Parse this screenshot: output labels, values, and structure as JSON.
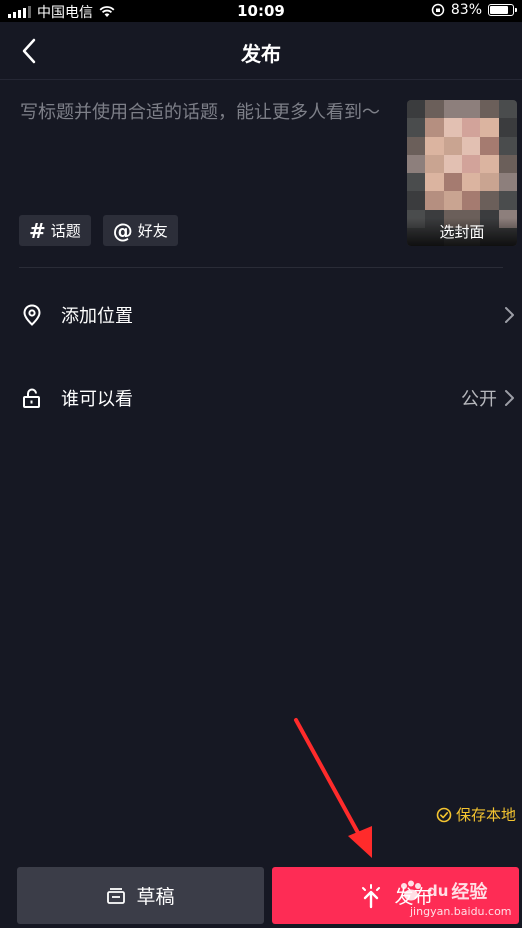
{
  "status_bar": {
    "carrier": "中国电信",
    "time": "10:09",
    "battery_percent": "83%",
    "battery_level": 0.83
  },
  "nav": {
    "title": "发布"
  },
  "composer": {
    "placeholder": "写标题并使用合适的话题，能让更多人看到～",
    "value": ""
  },
  "cover": {
    "label": "选封面"
  },
  "chips": [
    {
      "symbol": "#",
      "label": "话题"
    },
    {
      "symbol": "@",
      "label": "好友"
    }
  ],
  "settings": {
    "location": {
      "label": "添加位置"
    },
    "visibility": {
      "label": "谁可以看",
      "value": "公开"
    }
  },
  "save_local": {
    "label": "保存本地"
  },
  "actions": {
    "draft_label": "草稿",
    "publish_label": "发布"
  },
  "watermark": {
    "brand_text": "经验",
    "url": "jingyan.baidu.com"
  },
  "colors": {
    "background": "#161823",
    "accent": "#fe2c55",
    "save_local": "#f4c430",
    "annotation_arrow": "#ff2b2b"
  }
}
